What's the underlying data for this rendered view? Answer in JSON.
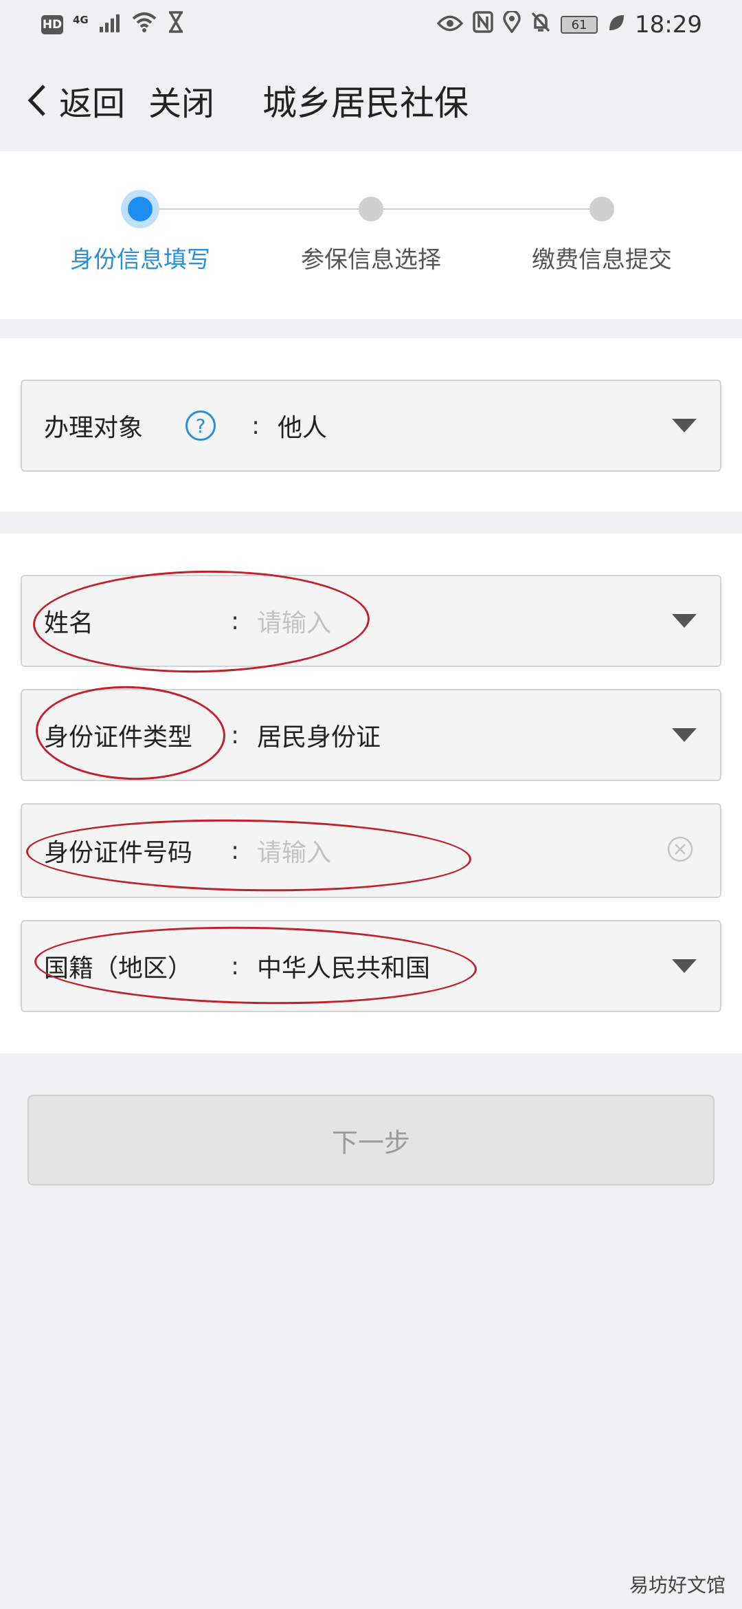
{
  "status_bar": {
    "hd": "HD",
    "network": "4G",
    "battery": "61",
    "time": "18:29"
  },
  "nav": {
    "back_label": "返回",
    "close_label": "关闭",
    "title": "城乡居民社保"
  },
  "steps": [
    {
      "label": "身份信息填写",
      "active": true
    },
    {
      "label": "参保信息选择",
      "active": false
    },
    {
      "label": "缴费信息提交",
      "active": false
    }
  ],
  "handler_field": {
    "label": "办理对象",
    "help": "?",
    "colon": ":",
    "value": "他人"
  },
  "form": {
    "name": {
      "label": "姓名",
      "colon": ":",
      "placeholder": "请输入"
    },
    "id_type": {
      "label": "身份证件类型",
      "colon": ":",
      "value": "居民身份证"
    },
    "id_number": {
      "label": "身份证件号码",
      "colon": ":",
      "placeholder": "请输入"
    },
    "nationality": {
      "label": "国籍（地区）",
      "colon": ":",
      "value": "中华人民共和国"
    }
  },
  "next_button": "下一步",
  "watermark": "易坊好文馆",
  "colors": {
    "accent": "#1e8ff0",
    "accent_text": "#2a8fd8",
    "annotation_red": "#c0212c"
  }
}
